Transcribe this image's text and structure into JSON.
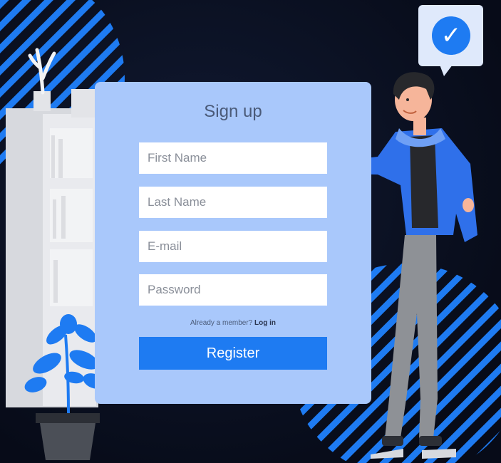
{
  "signup": {
    "title": "Sign up",
    "first_name_placeholder": "First Name",
    "last_name_placeholder": "Last Name",
    "email_placeholder": "E-mail",
    "password_placeholder": "Password",
    "already_member_text": "Already a member?",
    "login_link": "Log in",
    "register_label": "Register"
  },
  "badge": {
    "icon": "checkmark-icon",
    "symbol": "✓"
  },
  "colors": {
    "background": "#0b1124",
    "card": "#a9c8fb",
    "accent": "#1e7bf2",
    "stripes": "#1e7bf2"
  }
}
